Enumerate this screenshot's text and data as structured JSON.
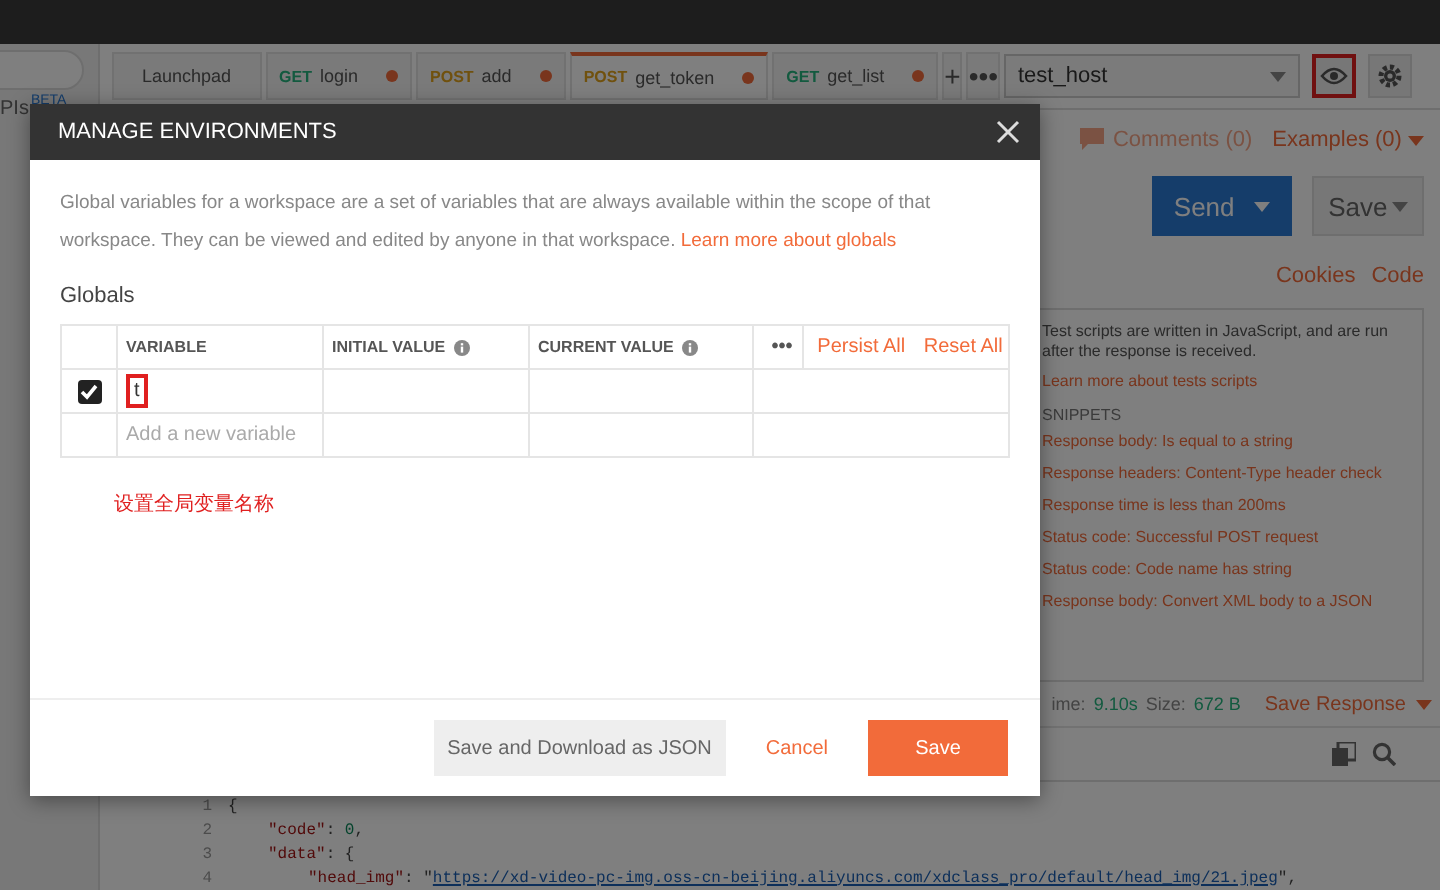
{
  "sidebar": {
    "label": "PIs",
    "badge": "BETA"
  },
  "tabs": [
    {
      "name": "Launchpad",
      "unsaved": false,
      "selected": false
    },
    {
      "method": "GET",
      "name": "login",
      "unsaved": true,
      "selected": false
    },
    {
      "method": "POST",
      "name": "add",
      "unsaved": true,
      "selected": false
    },
    {
      "method": "POST",
      "name": "get_token",
      "unsaved": true,
      "selected": true
    },
    {
      "method": "GET",
      "name": "get_list",
      "unsaved": true,
      "selected": false
    }
  ],
  "tab_actions": {
    "add": "+",
    "more": "•••"
  },
  "environment": {
    "value": "test_host",
    "eye_highlighted": true
  },
  "request": {
    "comments": "Comments (0)",
    "examples": "Examples (0)",
    "send": "Send",
    "save": "Save",
    "cookies": "Cookies",
    "code": "Code"
  },
  "tests_panel": {
    "intro": "Test scripts are written in JavaScript, and are run after the response is received.",
    "link": "Learn more about tests scripts",
    "snippets_title": "SNIPPETS",
    "snippets": [
      "Response body: Is equal to a string",
      "Response headers: Content-Type header check",
      "Response time is less than 200ms",
      "Status code: Successful POST request",
      "Status code: Code name has string",
      "Response body: Convert XML body to a JSON"
    ]
  },
  "response": {
    "time_label": "ime:",
    "time": "9.10s",
    "size_label": "Size:",
    "size": "672 B",
    "save_response": "Save Response",
    "lines": [
      {
        "number": "1",
        "tokens": [
          {
            "kind": "punct",
            "text": "{"
          }
        ],
        "children": [
          {
            "number": "2",
            "tokens": [
              {
                "kind": "key",
                "text": "\"code\""
              },
              {
                "kind": "punct",
                "text": ": "
              },
              {
                "kind": "number",
                "text": "0"
              },
              {
                "kind": "punct",
                "text": ","
              }
            ]
          },
          {
            "number": "3",
            "tokens": [
              {
                "kind": "key",
                "text": "\"data\""
              },
              {
                "kind": "punct",
                "text": ": {"
              }
            ],
            "children": [
              {
                "number": "4",
                "tokens": [
                  {
                    "kind": "key",
                    "text": "\"head_img\""
                  },
                  {
                    "kind": "punct",
                    "text": ": \""
                  },
                  {
                    "kind": "link",
                    "text": "https://xd-video-pc-img.oss-cn-beijing.aliyuncs.com/xdclass_pro/default/head_img/21.jpeg"
                  },
                  {
                    "kind": "punct",
                    "text": "\","
                  }
                ]
              }
            ]
          }
        ]
      }
    ]
  },
  "modal": {
    "title": "MANAGE ENVIRONMENTS",
    "description": "Global variables for a workspace are a set of variables that are always available within the scope of that workspace. They can be viewed and edited by anyone in that workspace.",
    "learn_more": "Learn more about globals",
    "section": "Globals",
    "columns": [
      "VARIABLE",
      "INITIAL VALUE",
      "CURRENT VALUE"
    ],
    "more": "•••",
    "persist_all": "Persist All",
    "reset_all": "Reset All",
    "rows": [
      {
        "checked": true,
        "variable": "t",
        "highlighted": true
      }
    ],
    "new_row_placeholder": "Add a new variable",
    "annotation": "设置全局变量名称",
    "buttons": {
      "download": "Save and Download as JSON",
      "cancel": "Cancel",
      "save": "Save"
    }
  }
}
